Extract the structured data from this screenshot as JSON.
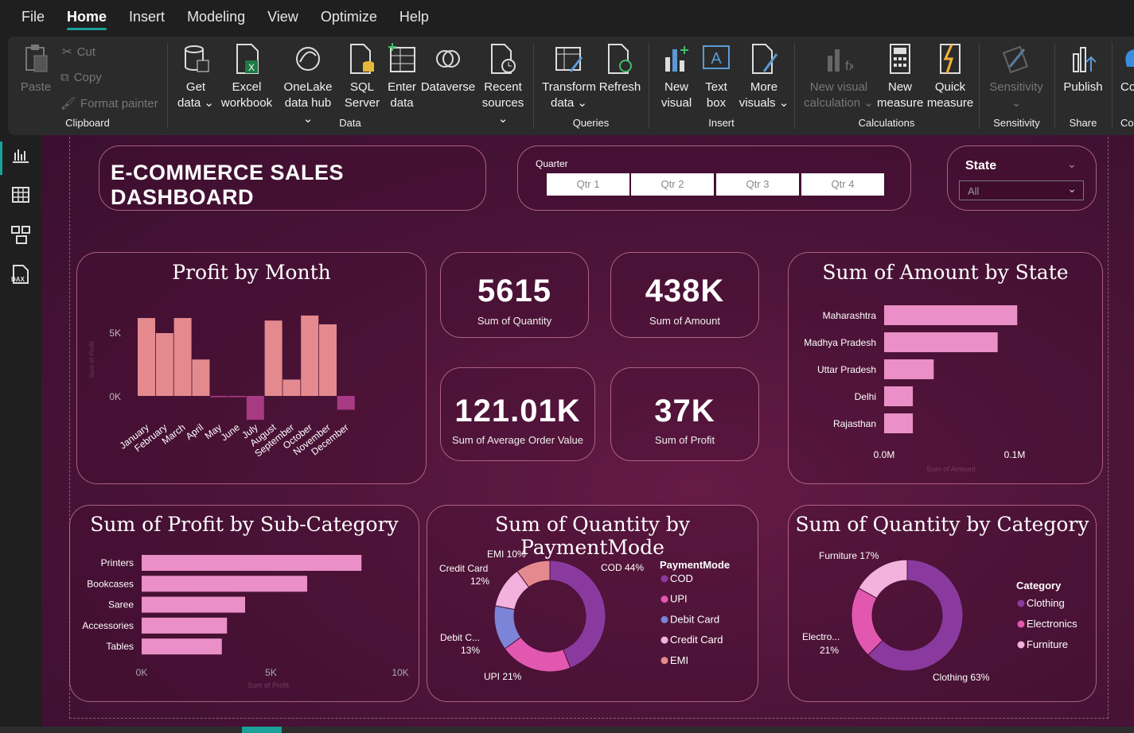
{
  "menu": [
    "File",
    "Home",
    "Insert",
    "Modeling",
    "View",
    "Optimize",
    "Help"
  ],
  "ribbon": {
    "clipboard": {
      "paste": "Paste",
      "cut": "Cut",
      "copy": "Copy",
      "format_painter": "Format painter",
      "label": "Clipboard"
    },
    "data": {
      "get_data": [
        "Get",
        "data"
      ],
      "excel": [
        "Excel",
        "workbook"
      ],
      "onelake": [
        "OneLake",
        "data hub"
      ],
      "sql": [
        "SQL",
        "Server"
      ],
      "enter": [
        "Enter",
        "data"
      ],
      "dataverse": "Dataverse",
      "recent": [
        "Recent",
        "sources"
      ],
      "label": "Data"
    },
    "queries": {
      "transform": [
        "Transform",
        "data"
      ],
      "refresh": "Refresh",
      "label": "Queries"
    },
    "insert": {
      "new_visual": [
        "New",
        "visual"
      ],
      "text_box": [
        "Text",
        "box"
      ],
      "more_visuals": [
        "More",
        "visuals"
      ],
      "label": "Insert"
    },
    "calculations": {
      "new_visual_calc": [
        "New visual",
        "calculation"
      ],
      "new_measure": [
        "New",
        "measure"
      ],
      "quick_measure": [
        "Quick",
        "measure"
      ],
      "label": "Calculations"
    },
    "sensitivity": {
      "btn": "Sensitivity",
      "label": "Sensitivity"
    },
    "share": {
      "publish": "Publish",
      "label": "Share"
    },
    "cut_off": "Co",
    "cut_off_label": "Co"
  },
  "dashboard": {
    "title": "E-COMMERCE SALES DASHBOARD",
    "quarter_slicer": {
      "label": "Quarter",
      "options": [
        "Qtr 1",
        "Qtr 2",
        "Qtr 3",
        "Qtr 4"
      ]
    },
    "state_slicer": {
      "label": "State",
      "value": "All"
    },
    "kpis": [
      {
        "value": "5615",
        "label": "Sum of Quantity"
      },
      {
        "value": "438K",
        "label": "Sum of Amount"
      },
      {
        "value": "121.01K",
        "label": "Sum of Average Order Value"
      },
      {
        "value": "37K",
        "label": "Sum of Profit"
      }
    ]
  },
  "colors": {
    "bar_pink": "#e48a8f",
    "bar_neg": "#a83a84",
    "hbar": "#ea8fc7",
    "cod": "#8a3a9e",
    "upi": "#e258b0",
    "debit": "#7b84d6",
    "credit": "#f2b2dd",
    "emi": "#e48a8f",
    "accent": "#1aa19a"
  },
  "chart_data": [
    {
      "type": "bar",
      "title": "Profit by Month",
      "ylabel": "Sum of Profit",
      "categories": [
        "January",
        "February",
        "March",
        "April",
        "May",
        "June",
        "July",
        "August",
        "September",
        "October",
        "November",
        "December"
      ],
      "values": [
        6200,
        5000,
        6200,
        2900,
        -100,
        -100,
        -1900,
        6000,
        1300,
        6400,
        5700,
        -1100
      ],
      "yticks": [
        "5K",
        "0K"
      ],
      "ylim": [
        -2500,
        7500
      ]
    },
    {
      "type": "bar",
      "orientation": "horizontal",
      "title": "Sum of Amount by State",
      "xlabel": "Sum of Amount",
      "categories": [
        "Maharashtra",
        "Madhya Pradesh",
        "Uttar Pradesh",
        "Delhi",
        "Rajasthan"
      ],
      "values": [
        102000,
        87000,
        38000,
        22000,
        22000
      ],
      "xticks": [
        "0.0M",
        "0.1M"
      ],
      "xlim": [
        0,
        100000
      ]
    },
    {
      "type": "bar",
      "orientation": "horizontal",
      "title": "Sum of Profit by Sub-Category",
      "xlabel": "Sum of Profit",
      "categories": [
        "Printers",
        "Bookcases",
        "Saree",
        "Accessories",
        "Tables"
      ],
      "values": [
        8500,
        6400,
        4000,
        3300,
        3100
      ],
      "xticks": [
        "0K",
        "5K",
        "10K"
      ],
      "xlim": [
        0,
        10000
      ]
    },
    {
      "type": "pie",
      "donut": true,
      "title": "Sum of Quantity by PaymentMode",
      "legend_title": "PaymentMode",
      "categories": [
        "COD",
        "UPI",
        "Debit Card",
        "Credit Card",
        "EMI"
      ],
      "values": [
        44,
        21,
        13,
        12,
        10
      ],
      "labels": [
        "COD 44%",
        "UPI 21%",
        "Debit C...",
        "13%",
        "Credit Card",
        "12%",
        "EMI 10%"
      ]
    },
    {
      "type": "pie",
      "donut": true,
      "title": "Sum of Quantity by Category",
      "legend_title": "Category",
      "categories": [
        "Clothing",
        "Electronics",
        "Furniture"
      ],
      "values": [
        63,
        21,
        17
      ],
      "labels": [
        "Clothing 63%",
        "Electro...",
        "21%",
        "Furniture 17%"
      ]
    }
  ]
}
